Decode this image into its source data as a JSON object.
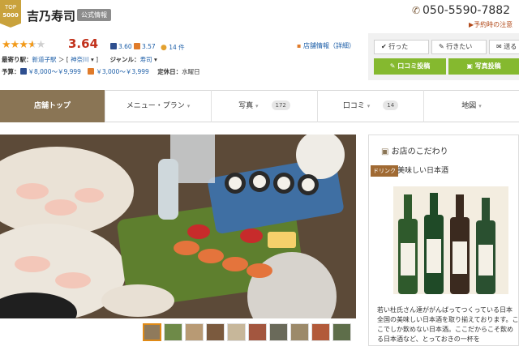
{
  "badge": {
    "label": "TOP",
    "number": "5000"
  },
  "shop": {
    "name": "吉乃寿司",
    "official_tag": "公式情報"
  },
  "phone": {
    "number": "050-5590-7882",
    "note": "▶予約時の注意"
  },
  "rating": {
    "score": "3.64",
    "stars_value": 3.64,
    "sub1": "3.60",
    "sub2": "3.57",
    "reviews": "14 件"
  },
  "info_link": "店舗情報（詳細）",
  "details": {
    "station_label": "最寄り駅：",
    "station": "新道子駅",
    "area": "神奈川",
    "genre_label": "ジャンル：",
    "genre": "寿司",
    "budget_label": "予算：",
    "budget_dinner": "￥8,000～￥9,999",
    "budget_lunch": "￥3,000～￥3,999",
    "holiday_label": "定休日：",
    "holiday": "水曜日"
  },
  "actions": {
    "went": "行った",
    "want": "行きたい",
    "send": "送る",
    "review": "口コミ投稿",
    "photo": "写真投稿"
  },
  "tabs": [
    {
      "label": "店舗トップ"
    },
    {
      "label": "メニュー・プラン"
    },
    {
      "label": "写真",
      "count": "172"
    },
    {
      "label": "口コミ",
      "count": "14"
    },
    {
      "label": "地図"
    }
  ],
  "kodawari": {
    "title": "お店のこだわり",
    "tag": "ドリンク",
    "subtitle": "美味しい日本酒",
    "text": "若い杜氏さん達ががんばってつくっている日本全国の美味しい日本酒を取り揃えております。ここでしか飲めない日本酒。ここだからこそ飲める日本酒など、とっておきの一杯を"
  },
  "colors": {
    "accent_red": "#c2311b",
    "brand_brown": "#8a7555",
    "green": "#85b92f",
    "link_blue": "#1e5fa8",
    "star": "#f29a1a"
  }
}
